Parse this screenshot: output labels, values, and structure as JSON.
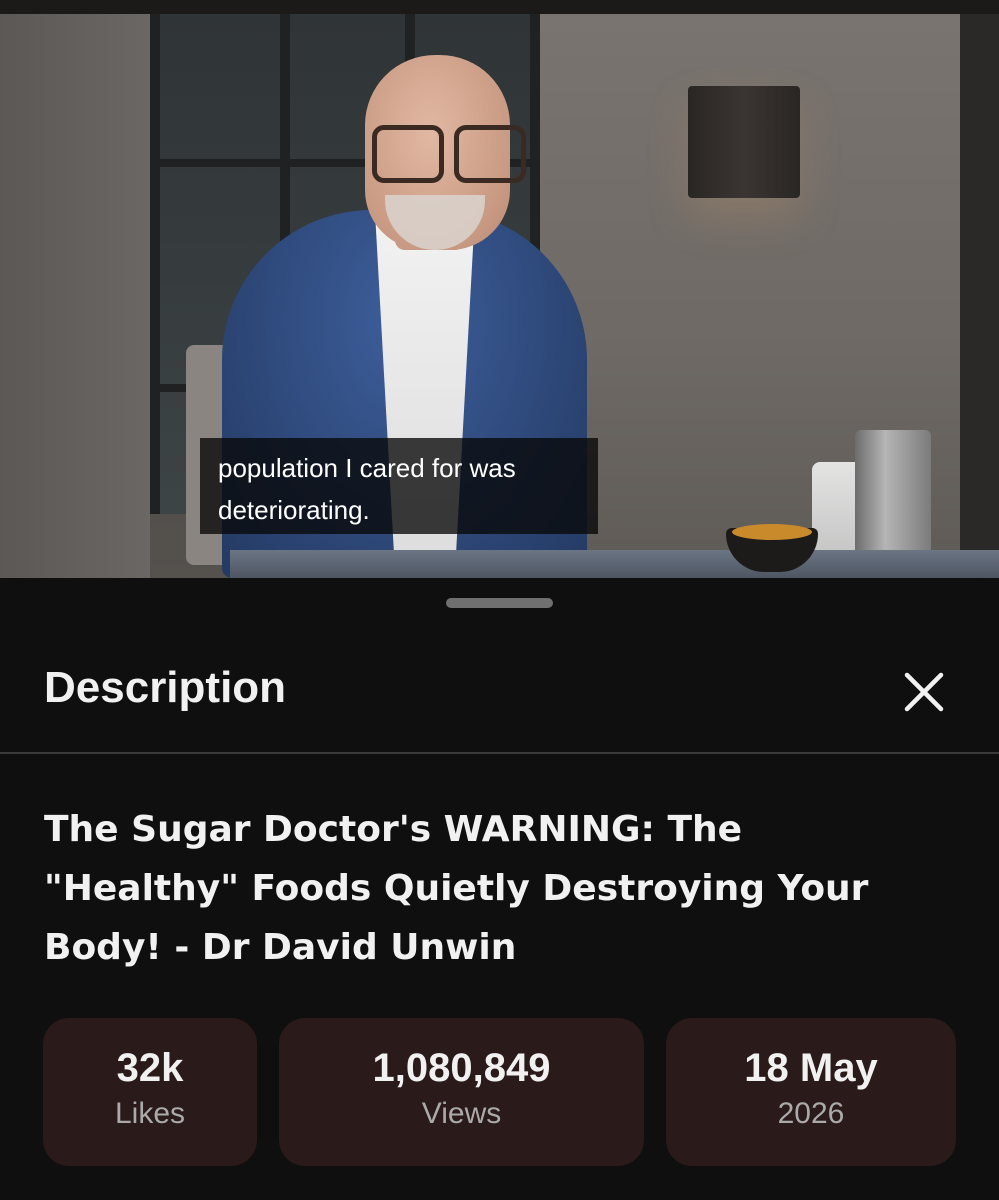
{
  "video": {
    "subtitle_lines": [
      "population I cared for was",
      "deteriorating."
    ]
  },
  "sheet": {
    "title": "Description",
    "close_icon": "close-icon",
    "video_title_lines": [
      "The Sugar Doctor's WARNING: The",
      "\"Healthy\" Foods Quietly Destroying Your",
      "Body! - Dr David Unwin"
    ],
    "stats": {
      "likes": {
        "value": "32k",
        "label": "Likes"
      },
      "views": {
        "value": "1,080,849",
        "label": "Views"
      },
      "date": {
        "value": "18 May",
        "label": "2026"
      }
    }
  },
  "colors": {
    "background": "#0f0f0f",
    "stat_card": "#2a1a19",
    "text_primary": "#f1f1f1",
    "text_secondary": "#aaaaaa"
  }
}
